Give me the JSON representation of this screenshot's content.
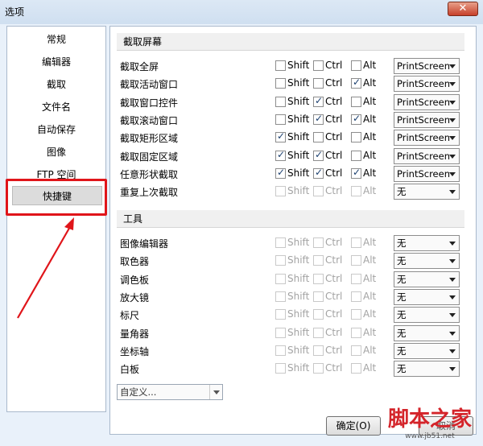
{
  "window": {
    "title": "选项",
    "close_glyph": "✕"
  },
  "sidebar": {
    "items": [
      {
        "label": "常规",
        "active": false
      },
      {
        "label": "编辑器",
        "active": false
      },
      {
        "label": "截取",
        "active": false
      },
      {
        "label": "文件名",
        "active": false
      },
      {
        "label": "自动保存",
        "active": false
      },
      {
        "label": "图像",
        "active": false
      },
      {
        "label": "FTP 空间",
        "active": false
      },
      {
        "label": "快捷键",
        "active": true
      }
    ]
  },
  "annotation": {
    "highlight_color": "#e0151a"
  },
  "sections": [
    {
      "title": "截取屏幕",
      "rows": [
        {
          "label": "截取全屏",
          "shift": false,
          "ctrl": false,
          "alt": false,
          "key": "PrintScreen",
          "enabled": true
        },
        {
          "label": "截取活动窗口",
          "shift": false,
          "ctrl": false,
          "alt": true,
          "key": "PrintScreen",
          "enabled": true
        },
        {
          "label": "截取窗口控件",
          "shift": false,
          "ctrl": true,
          "alt": false,
          "key": "PrintScreen",
          "enabled": true
        },
        {
          "label": "截取滚动窗口",
          "shift": false,
          "ctrl": true,
          "alt": true,
          "key": "PrintScreen",
          "enabled": true
        },
        {
          "label": "截取矩形区域",
          "shift": true,
          "ctrl": false,
          "alt": false,
          "key": "PrintScreen",
          "enabled": true
        },
        {
          "label": "截取固定区域",
          "shift": true,
          "ctrl": true,
          "alt": false,
          "key": "PrintScreen",
          "enabled": true
        },
        {
          "label": "任意形状截取",
          "shift": true,
          "ctrl": true,
          "alt": true,
          "key": "PrintScreen",
          "enabled": true
        },
        {
          "label": "重复上次截取",
          "shift": false,
          "ctrl": false,
          "alt": false,
          "key": "无",
          "enabled": false
        }
      ]
    },
    {
      "title": "工具",
      "rows": [
        {
          "label": "图像编辑器",
          "shift": false,
          "ctrl": false,
          "alt": false,
          "key": "无",
          "enabled": false
        },
        {
          "label": "取色器",
          "shift": false,
          "ctrl": false,
          "alt": false,
          "key": "无",
          "enabled": false
        },
        {
          "label": "调色板",
          "shift": false,
          "ctrl": false,
          "alt": false,
          "key": "无",
          "enabled": false
        },
        {
          "label": "放大镜",
          "shift": false,
          "ctrl": false,
          "alt": false,
          "key": "无",
          "enabled": false
        },
        {
          "label": "标尺",
          "shift": false,
          "ctrl": false,
          "alt": false,
          "key": "无",
          "enabled": false
        },
        {
          "label": "量角器",
          "shift": false,
          "ctrl": false,
          "alt": false,
          "key": "无",
          "enabled": false
        },
        {
          "label": "坐标轴",
          "shift": false,
          "ctrl": false,
          "alt": false,
          "key": "无",
          "enabled": false
        },
        {
          "label": "白板",
          "shift": false,
          "ctrl": false,
          "alt": false,
          "key": "无",
          "enabled": false
        }
      ]
    }
  ],
  "modifiers": {
    "shift": "Shift",
    "ctrl": "Ctrl",
    "alt": "Alt"
  },
  "preset_select": {
    "value": "自定义..."
  },
  "buttons": {
    "ok": "确定(O)",
    "second": "取消"
  },
  "watermark": {
    "logo": "脚本之家",
    "url": "www.jb51.net"
  }
}
